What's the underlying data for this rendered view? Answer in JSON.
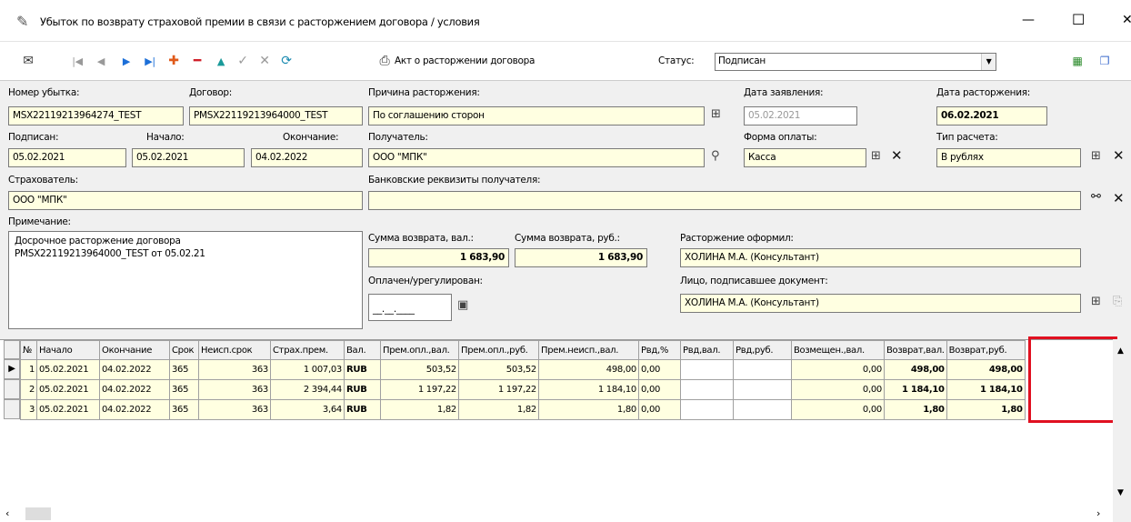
{
  "window": {
    "title": "Убыток по возврату страховой премии в связи с расторжением договора / условия",
    "minimize_glyph": "—",
    "maximize_glyph": "☐",
    "close_glyph": "✕"
  },
  "toolbar": {
    "act_label": "Акт о расторжении договора",
    "status_label": "Статус:",
    "status_value": "Подписан",
    "icons": [
      "mail-icon",
      "first-icon",
      "prev-icon",
      "next-icon",
      "last-icon",
      "add-icon",
      "delete-icon",
      "up-icon",
      "confirm-icon",
      "cancel-icon",
      "refresh-icon",
      "printer-icon",
      "report-icon",
      "copy-icon"
    ]
  },
  "form": {
    "loss_number_label": "Номер убытка:",
    "loss_number": "MSX22119213964274_TEST",
    "contract_label": "Договор:",
    "contract": "PMSX22119213964000_TEST",
    "reason_label": "Причина расторжения:",
    "reason": "По соглашению сторон",
    "application_date_label": "Дата заявления:",
    "application_date": "05.02.2021",
    "termination_date_label": "Дата расторжения:",
    "termination_date": "06.02.2021",
    "signed_label": "Подписан:",
    "signed": "05.02.2021",
    "start_label": "Начало:",
    "start": "05.02.2021",
    "end_label": "Окончание:",
    "end": "04.02.2022",
    "recipient_label": "Получатель:",
    "recipient": "ООО \"МПК\"",
    "payment_form_label": "Форма оплаты:",
    "payment_form": "Касса",
    "calc_type_label": "Тип расчета:",
    "calc_type": "В рублях",
    "insurer_label": "Страхователь:",
    "insurer": "ООО \"МПК\"",
    "bank_label": "Банковские реквизиты получателя:",
    "bank": "",
    "note_label": "Примечание:",
    "note": "Досрочное расторжение договора\nPMSX22119213964000_TEST от 05.02.21",
    "sum_cur_label": "Сумма возврата, вал.:",
    "sum_cur": "1 683,90",
    "sum_rub_label": "Сумма возврата, руб.:",
    "sum_rub": "1 683,90",
    "paid_label": "Оплачен/урегулирован:",
    "paid": "__.__.____",
    "issued_by_label": "Расторжение оформил:",
    "issued_by": "ХОЛИНА М.А. (Консультант)",
    "signer_label": "Лицо, подписавшее документ:",
    "signer": "ХОЛИНА М.А. (Консультант)"
  },
  "grid": {
    "columns": [
      "№",
      "Начало",
      "Окончание",
      "Срок",
      "Неисп.срок",
      "Страх.прем.",
      "Вал.",
      "Прем.опл.,вал.",
      "Прем.опл.,руб.",
      "Прем.неисп.,вал.",
      "Рвд,%",
      "Рвд,вал.",
      "Рвд,руб.",
      "Возмещен.,вал.",
      "Возврат,вал.",
      "Возврат,руб."
    ],
    "rows": [
      [
        "1",
        "05.02.2021",
        "04.02.2022",
        "365",
        "363",
        "1 007,03",
        "RUB",
        "503,52",
        "503,52",
        "498,00",
        "0,00",
        "",
        "",
        "0,00",
        "498,00",
        "498,00"
      ],
      [
        "2",
        "05.02.2021",
        "04.02.2022",
        "365",
        "363",
        "2 394,44",
        "RUB",
        "1 197,22",
        "1 197,22",
        "1 184,10",
        "0,00",
        "",
        "",
        "0,00",
        "1 184,10",
        "1 184,10"
      ],
      [
        "3",
        "05.02.2021",
        "04.02.2022",
        "365",
        "363",
        "3,64",
        "RUB",
        "1,82",
        "1,82",
        "1,80",
        "0,00",
        "",
        "",
        "0,00",
        "1,80",
        "1,80"
      ]
    ]
  }
}
